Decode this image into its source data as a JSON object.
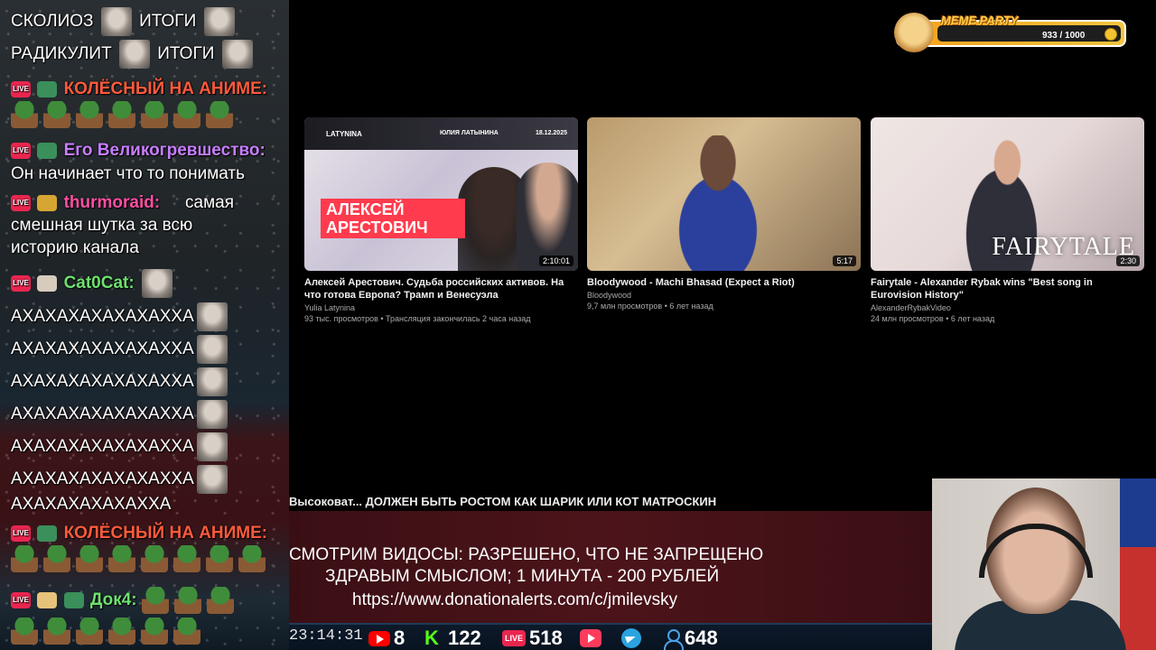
{
  "chat": {
    "messages": [
      {
        "text": "СКОЛИОЗ",
        "text2": "ИТОГИ"
      },
      {
        "text": "РАДИКУЛИТ",
        "text2": "ИТОГИ"
      },
      {
        "user": "КОЛЁСНЫЙ НА АНИМЕ:",
        "user_color": "#ff5a3c"
      },
      {
        "user": "Его Великогревшество:",
        "user_color": "#c77dff",
        "text": "Он начинает что то понимать"
      },
      {
        "user": "thurmoraid:",
        "user_color": "#ff4fa3",
        "text": "самая смешная шутка за всю историю канала"
      },
      {
        "user": "Cat0Cat:",
        "user_color": "#6ee06e"
      },
      {
        "text": "АХАХАХАХАХАХАХХА"
      },
      {
        "text": "АХАХАХАХАХАХАХХА"
      },
      {
        "text": "АХАХАХАХАХАХАХХА"
      },
      {
        "text": "АХАХАХАХАХАХАХХА"
      },
      {
        "text": "АХАХАХАХАХАХАХХА"
      },
      {
        "text": "АХАХАХАХАХАХАХХА"
      },
      {
        "text": "АХАХАХАХАХАХХА"
      },
      {
        "user": "КОЛЁСНЫЙ НА АНИМЕ:",
        "user_color": "#ff5a3c"
      },
      {
        "user": "Док4:",
        "user_color": "#6ee06e"
      }
    ],
    "live_badge": "LIVE"
  },
  "topbar": {
    "title": "MEME PARTY",
    "progress": "933 / 1000"
  },
  "videos": [
    {
      "title": "Алексей Арестович. Судьба российских активов. На что готова Европа? Трамп и Венесуэла",
      "channel": "Yulia Latynina",
      "meta": "93 тыс. просмотров • Трансляция закончилась 2 часа назад",
      "duration": "2:10:01",
      "thumb_brand": "LATYNINA",
      "thumb_host": "ЮЛИЯ ЛАТЫНИНА",
      "thumb_date": "18.12.2025",
      "thumb_title": "АЛЕКСЕЙ АРЕСТОВИЧ"
    },
    {
      "title": "Bloodywood - Machi Bhasad (Expect a Riot)",
      "channel": "Bloodywood",
      "meta": "9,7 млн просмотров • 6 лет назад",
      "duration": "5:17"
    },
    {
      "title": "Fairytale - Alexander Rybak wins \"Best song in Eurovision History\"",
      "channel": "AlexanderRybakVideo",
      "meta": "24 млн просмотров • 6 лет назад",
      "duration": "2:30",
      "thumb_title": "FAIRYTALE"
    }
  ],
  "ticker": "Высоковат... ДОЛЖЕН БЫТЬ РОСТОМ КАК ШАРИК ИЛИ КОТ МАТРОСКИН",
  "info": {
    "line1": "СМОТРИМ ВИДОСЫ: РАЗРЕШЕНО, ЧТО НЕ ЗАПРЕЩЕНО",
    "line2": "ЗДРАВЫМ СМЫСЛОМ; 1 МИНУТА - 200 РУБЛЕЙ",
    "line3": "https://www.donationalerts.com/c/jmilevsky"
  },
  "status": {
    "clock": "23:14:31",
    "youtube": "8",
    "kick": "122",
    "live": "518",
    "live_label": "LIVE",
    "kick_label": "K",
    "viewers": "648"
  }
}
